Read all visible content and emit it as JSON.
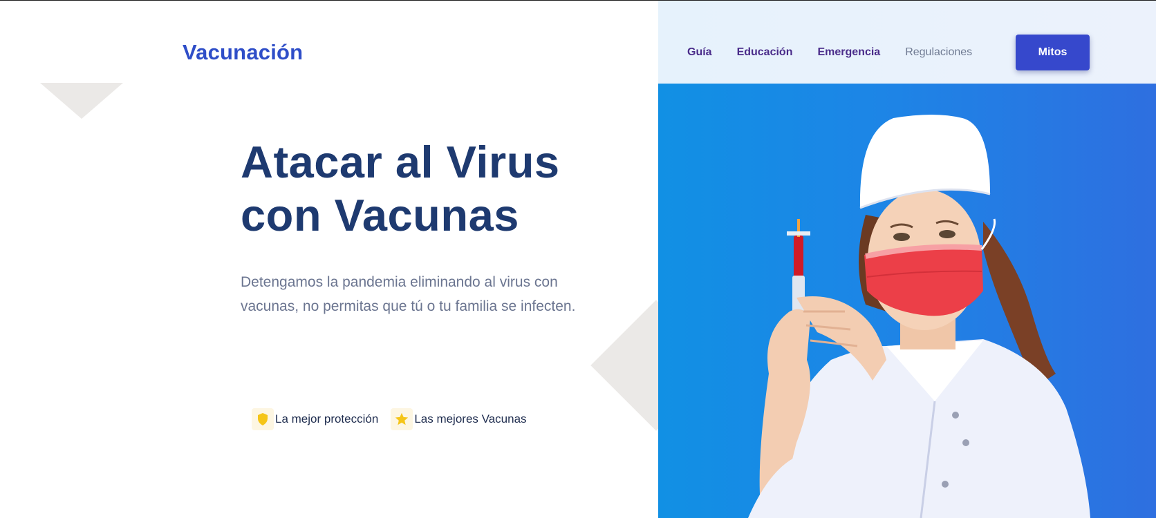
{
  "brand": {
    "logo_text": "Vacunación"
  },
  "nav": {
    "items": [
      {
        "label": "Guía"
      },
      {
        "label": "Educación"
      },
      {
        "label": "Emergencia"
      },
      {
        "label": "Regulaciones"
      }
    ],
    "cta_label": "Mitos"
  },
  "hero": {
    "headline_line1": "Atacar al Virus",
    "headline_line2": "con Vacunas",
    "subtitle": "Detengamos la pandemia eliminando al virus con vacunas, no permitas que tú o tu familia se infecten.",
    "features": [
      {
        "icon": "shield-icon",
        "label": "La mejor protección"
      },
      {
        "icon": "star-icon",
        "label": "Las mejores Vacunas"
      }
    ]
  },
  "colors": {
    "brand": "#2f4ec8",
    "headline": "#1e3a70",
    "cta": "#3648cc",
    "hero_blue": "#1d85e6",
    "icon_yellow": "#f5c518"
  }
}
